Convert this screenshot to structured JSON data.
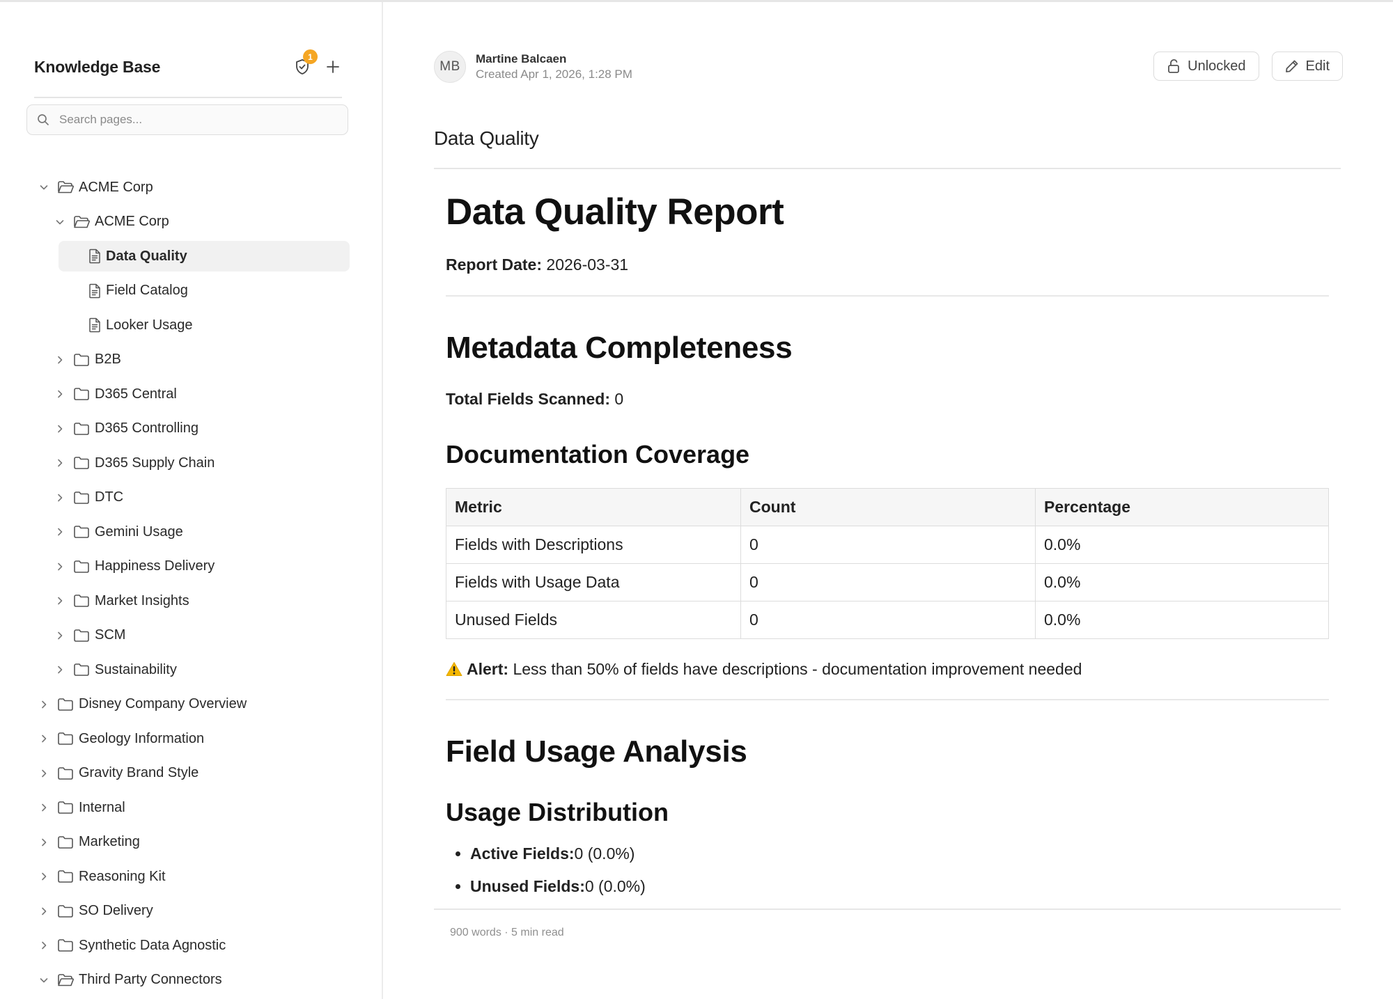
{
  "sidebar": {
    "title": "Knowledge Base",
    "notification_count": "1",
    "search_placeholder": "Search pages...",
    "items": [
      {
        "label": "ACME Corp",
        "level": 0,
        "type": "folder-open",
        "expanded": true
      },
      {
        "label": "ACME Corp",
        "level": 1,
        "type": "folder-open",
        "expanded": true
      },
      {
        "label": "Data Quality",
        "level": 2,
        "type": "page",
        "selected": true
      },
      {
        "label": "Field Catalog",
        "level": 2,
        "type": "page"
      },
      {
        "label": "Looker Usage",
        "level": 2,
        "type": "page"
      },
      {
        "label": "B2B",
        "level": 1,
        "type": "folder"
      },
      {
        "label": "D365 Central",
        "level": 1,
        "type": "folder"
      },
      {
        "label": "D365 Controlling",
        "level": 1,
        "type": "folder"
      },
      {
        "label": "D365 Supply Chain",
        "level": 1,
        "type": "folder"
      },
      {
        "label": "DTC",
        "level": 1,
        "type": "folder"
      },
      {
        "label": "Gemini Usage",
        "level": 1,
        "type": "folder"
      },
      {
        "label": "Happiness Delivery",
        "level": 1,
        "type": "folder"
      },
      {
        "label": "Market Insights",
        "level": 1,
        "type": "folder"
      },
      {
        "label": "SCM",
        "level": 1,
        "type": "folder"
      },
      {
        "label": "Sustainability",
        "level": 1,
        "type": "folder"
      },
      {
        "label": "Disney Company Overview",
        "level": 0,
        "type": "folder"
      },
      {
        "label": "Geology Information",
        "level": 0,
        "type": "folder"
      },
      {
        "label": "Gravity Brand Style",
        "level": 0,
        "type": "folder"
      },
      {
        "label": "Internal",
        "level": 0,
        "type": "folder"
      },
      {
        "label": "Marketing",
        "level": 0,
        "type": "folder"
      },
      {
        "label": "Reasoning Kit",
        "level": 0,
        "type": "folder"
      },
      {
        "label": "SO Delivery",
        "level": 0,
        "type": "folder"
      },
      {
        "label": "Synthetic Data Agnostic",
        "level": 0,
        "type": "folder"
      },
      {
        "label": "Third Party Connectors",
        "level": 0,
        "type": "folder-open",
        "expanded": true
      }
    ]
  },
  "header": {
    "avatar_initials": "MB",
    "author_name": "Martine Balcaen",
    "created": "Created Apr 1, 2026, 1:28 PM",
    "unlocked_label": "Unlocked",
    "edit_label": "Edit",
    "page_title": "Data Quality"
  },
  "doc": {
    "h1": "Data Quality Report",
    "report_date_label": "Report Date:",
    "report_date_value": " 2026-03-31",
    "h2_metadata": "Metadata Completeness",
    "total_fields_label": "Total Fields Scanned:",
    "total_fields_value": " 0",
    "h3_coverage": "Documentation Coverage",
    "table": {
      "headers": [
        "Metric",
        "Count",
        "Percentage"
      ],
      "rows": [
        [
          "Fields with Descriptions",
          "0",
          "0.0%"
        ],
        [
          "Fields with Usage Data",
          "0",
          "0.0%"
        ],
        [
          "Unused Fields",
          "0",
          "0.0%"
        ]
      ]
    },
    "alert_label": "Alert:",
    "alert_text": " Less than 50% of fields have descriptions - documentation improvement needed",
    "h2_usage": "Field Usage Analysis",
    "h3_distribution": "Usage Distribution",
    "bullets": [
      {
        "label": "Active Fields:",
        "value": " 0 (0.0%)"
      },
      {
        "label": "Unused Fields:",
        "value": " 0 (0.0%)"
      }
    ]
  },
  "footer": {
    "stats": "900 words · 5 min read"
  },
  "colors": {
    "badge": "#f5a623",
    "alert": "#f5b700",
    "selected_bg": "#f1f1f1"
  }
}
